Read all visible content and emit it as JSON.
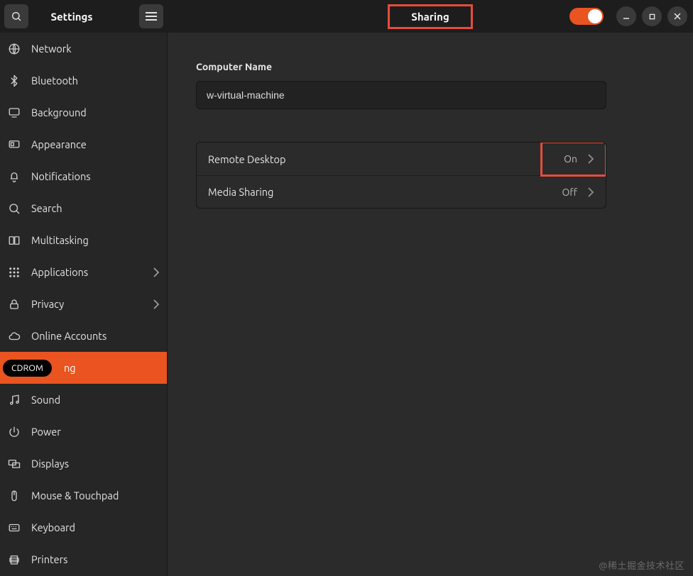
{
  "titlebar": {
    "settings_label": "Settings",
    "page_title": "Sharing"
  },
  "master_toggle": {
    "on": true
  },
  "sidebar": {
    "items": [
      {
        "label": "Network",
        "icon": "globe"
      },
      {
        "label": "Bluetooth",
        "icon": "bluetooth"
      },
      {
        "label": "Background",
        "icon": "display"
      },
      {
        "label": "Appearance",
        "icon": "appearance"
      },
      {
        "label": "Notifications",
        "icon": "bell"
      },
      {
        "label": "Search",
        "icon": "search"
      },
      {
        "label": "Multitasking",
        "icon": "multitask"
      },
      {
        "label": "Applications",
        "icon": "grid",
        "chevron": true
      },
      {
        "label": "Privacy",
        "icon": "lock",
        "chevron": true
      },
      {
        "label": "Online Accounts",
        "icon": "cloud"
      },
      {
        "label": "Sharing",
        "icon": "share",
        "active": true,
        "partial_suffix": "ng",
        "overlay": "CDROM"
      },
      {
        "label": "Sound",
        "icon": "music"
      },
      {
        "label": "Power",
        "icon": "power"
      },
      {
        "label": "Displays",
        "icon": "displays"
      },
      {
        "label": "Mouse & Touchpad",
        "icon": "mouse"
      },
      {
        "label": "Keyboard",
        "icon": "keyboard"
      },
      {
        "label": "Printers",
        "icon": "printer"
      }
    ]
  },
  "content": {
    "computer_name_label": "Computer Name",
    "computer_name_value": "w-virtual-machine",
    "rows": [
      {
        "label": "Remote Desktop",
        "state": "On",
        "highlight": true
      },
      {
        "label": "Media Sharing",
        "state": "Off",
        "highlight": false
      }
    ]
  },
  "watermark": "@稀土掘金技术社区"
}
